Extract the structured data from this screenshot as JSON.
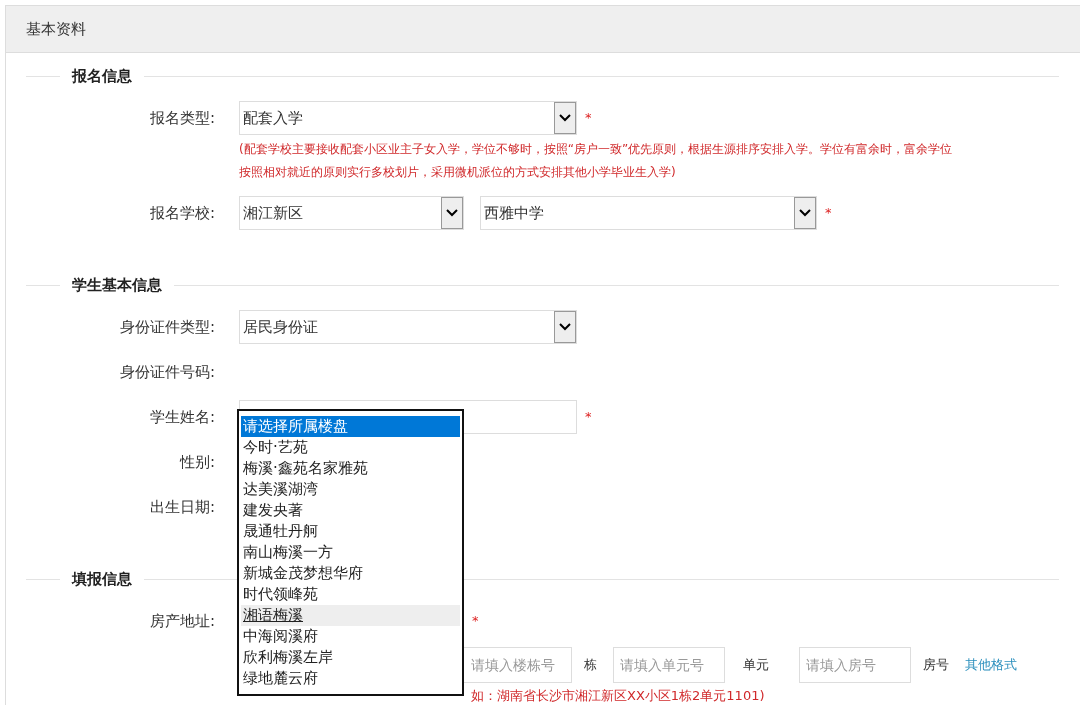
{
  "header": {
    "title": "基本资料"
  },
  "sections": [
    {
      "title": "报名信息",
      "fields": [
        {
          "kind": "select",
          "label": "报名类型:",
          "value": "配套入学",
          "required_mark": "*",
          "note": "(配套学校主要接收配套小区业主子女入学，学位不够时，按照“房户一致”优先原则，根据生源排序安排入学。学位有富余时，富余学位按照相对就近的原则实行多校划片，采用微机派位的方式安排其他小学毕业生入学)"
        },
        {
          "kind": "select_pair",
          "label": "报名学校:",
          "values": [
            "湘江新区",
            "西雅中学"
          ],
          "required_mark": "*"
        }
      ]
    },
    {
      "title": "学生基本信息",
      "fields": [
        {
          "kind": "select",
          "label": "身份证件类型:",
          "value": "居民身份证"
        },
        {
          "kind": "text",
          "label": "身份证件号码:"
        },
        {
          "kind": "input",
          "label": "学生姓名:",
          "required_mark": "*"
        },
        {
          "kind": "text",
          "label": "性别:"
        },
        {
          "kind": "text",
          "label": "出生日期:"
        }
      ]
    },
    {
      "title": "填报信息",
      "fields": [
        {
          "kind": "address",
          "label": "房产地址:",
          "required_mark": "*",
          "parts": [
            {
              "placeholder": "请填入楼栋号",
              "unit": "栋"
            },
            {
              "placeholder": "请填入单元号",
              "unit": "单元"
            },
            {
              "placeholder": "请填入房号",
              "unit": "房号"
            }
          ],
          "link": "其他格式",
          "note": "如：湖南省长沙市湘江新区XX小区1栋2单元1101)"
        }
      ]
    }
  ],
  "dropdown": {
    "options": [
      {
        "label": "请选择所属楼盘",
        "selected": true,
        "hovered": false
      },
      {
        "label": "今时·艺苑",
        "selected": false,
        "hovered": false
      },
      {
        "label": "梅溪·鑫苑名家雅苑",
        "selected": false,
        "hovered": false
      },
      {
        "label": "达美溪湖湾",
        "selected": false,
        "hovered": false
      },
      {
        "label": "建发央著",
        "selected": false,
        "hovered": false
      },
      {
        "label": "晟通牡丹舸",
        "selected": false,
        "hovered": false
      },
      {
        "label": "南山梅溪一方",
        "selected": false,
        "hovered": false
      },
      {
        "label": "新城金茂梦想华府",
        "selected": false,
        "hovered": false
      },
      {
        "label": "时代领峰苑",
        "selected": false,
        "hovered": false
      },
      {
        "label": "湘语梅溪",
        "selected": false,
        "hovered": true
      },
      {
        "label": "中海阅溪府",
        "selected": false,
        "hovered": false
      },
      {
        "label": "欣利梅溪左岸",
        "selected": false,
        "hovered": false
      },
      {
        "label": "绿地麓云府",
        "selected": false,
        "hovered": false
      }
    ]
  }
}
